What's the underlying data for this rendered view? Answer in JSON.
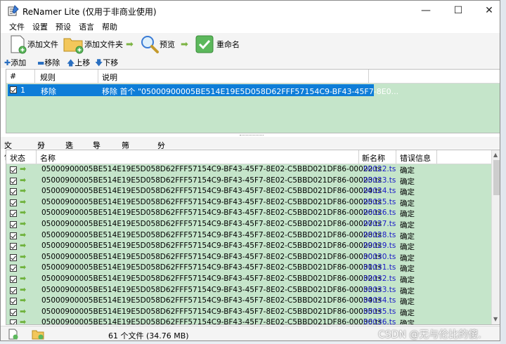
{
  "window": {
    "title": "ReNamer Lite  (仅用于非商业使用)",
    "controls": [
      "—",
      "☐",
      "✕"
    ]
  },
  "menu": [
    "文件",
    "设置",
    "预设",
    "语言",
    "帮助"
  ],
  "toolbar": {
    "add_files": "添加文件",
    "add_folders": "添加文件夹",
    "preview": "预览",
    "rename": "重命名"
  },
  "rules_toolbar": {
    "add": "添加",
    "remove": "移除",
    "up": "上移",
    "down": "下移"
  },
  "rules_table": {
    "headers": [
      "#",
      "规则",
      "说明"
    ],
    "rows": [
      {
        "num": "1",
        "rule": "移除",
        "desc": "移除 首个 \"05000900005BE514E19E5D058D62FFF57154C9-BF43-45F7-8E0..."
      }
    ]
  },
  "files_toolbar": {
    "files": "文件",
    "columns": "分栏",
    "options": "选项",
    "export": "导出",
    "filter": "筛选器",
    "analyze": "分析"
  },
  "files_table": {
    "headers": [
      "状态",
      "名称",
      "新名称",
      "错误信息"
    ],
    "rows": [
      {
        "name": "05000900005BE514E19E5D058D62FFF57154C9-BF43-45F7-8E02-C5BBD021DF86-00022.ts",
        "new": "00022.ts",
        "status": "确定"
      },
      {
        "name": "05000900005BE514E19E5D058D62FFF57154C9-BF43-45F7-8E02-C5BBD021DF86-00023.ts",
        "new": "00023.ts",
        "status": "确定"
      },
      {
        "name": "05000900005BE514E19E5D058D62FFF57154C9-BF43-45F7-8E02-C5BBD021DF86-00024.ts",
        "new": "00024.ts",
        "status": "确定"
      },
      {
        "name": "05000900005BE514E19E5D058D62FFF57154C9-BF43-45F7-8E02-C5BBD021DF86-00025.ts",
        "new": "00025.ts",
        "status": "确定"
      },
      {
        "name": "05000900005BE514E19E5D058D62FFF57154C9-BF43-45F7-8E02-C5BBD021DF86-00026.ts",
        "new": "00026.ts",
        "status": "确定"
      },
      {
        "name": "05000900005BE514E19E5D058D62FFF57154C9-BF43-45F7-8E02-C5BBD021DF86-00027.ts",
        "new": "00027.ts",
        "status": "确定"
      },
      {
        "name": "05000900005BE514E19E5D058D62FFF57154C9-BF43-45F7-8E02-C5BBD021DF86-00028.ts",
        "new": "00028.ts",
        "status": "确定"
      },
      {
        "name": "05000900005BE514E19E5D058D62FFF57154C9-BF43-45F7-8E02-C5BBD021DF86-00029.ts",
        "new": "00029.ts",
        "status": "确定"
      },
      {
        "name": "05000900005BE514E19E5D058D62FFF57154C9-BF43-45F7-8E02-C5BBD021DF86-00030.ts",
        "new": "00030.ts",
        "status": "确定"
      },
      {
        "name": "05000900005BE514E19E5D058D62FFF57154C9-BF43-45F7-8E02-C5BBD021DF86-00031.ts",
        "new": "00031.ts",
        "status": "确定"
      },
      {
        "name": "05000900005BE514E19E5D058D62FFF57154C9-BF43-45F7-8E02-C5BBD021DF86-00032.ts",
        "new": "00032.ts",
        "status": "确定"
      },
      {
        "name": "05000900005BE514E19E5D058D62FFF57154C9-BF43-45F7-8E02-C5BBD021DF86-00033.ts",
        "new": "00033.ts",
        "status": "确定"
      },
      {
        "name": "05000900005BE514E19E5D058D62FFF57154C9-BF43-45F7-8E02-C5BBD021DF86-00034.ts",
        "new": "00034.ts",
        "status": "确定"
      },
      {
        "name": "05000900005BE514E19E5D058D62FFF57154C9-BF43-45F7-8E02-C5BBD021DF86-00035.ts",
        "new": "00035.ts",
        "status": "确定"
      },
      {
        "name": "05000900005BE514E19E5D058D62FFF57154C9-BF43-45F7-8E02-C5BBD021DF86-00036.ts",
        "new": "00036.ts",
        "status": "确定"
      }
    ]
  },
  "statusbar": {
    "summary": "61 个文件 (34.76 MB)"
  },
  "watermark": "CSDN @无与伦比的傻.",
  "colors": {
    "row_green": "#c5e5ca",
    "selection_blue": "#0e7dd8",
    "new_name_blue": "#1a1ac8",
    "arrow_green": "#6fb23c"
  }
}
